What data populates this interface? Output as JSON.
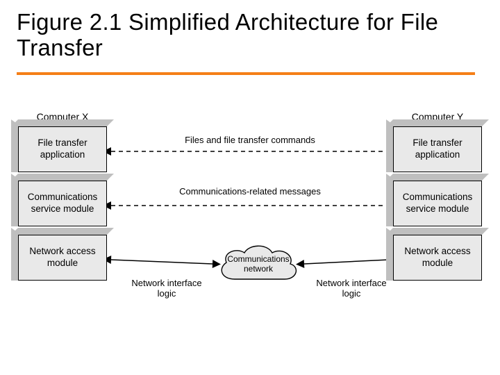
{
  "title": "Figure 2.1 Simplified Architecture for File Transfer",
  "computers": {
    "x": {
      "label": "Computer X"
    },
    "y": {
      "label": "Computer Y"
    }
  },
  "layers": {
    "file_transfer": "File transfer application",
    "comm_service": "Communications service module",
    "net_access": "Network access module"
  },
  "connections": {
    "files_cmds": "Files and file transfer commands",
    "comm_msgs": "Communications-related messages",
    "net_if_logic": "Network interface logic"
  },
  "cloud": {
    "line1": "Communications",
    "line2": "network"
  }
}
